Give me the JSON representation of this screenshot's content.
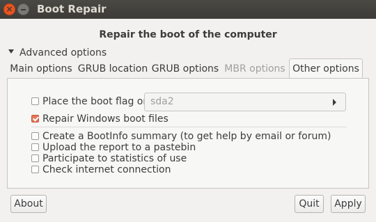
{
  "window": {
    "title": "Boot Repair",
    "close_glyph": "×"
  },
  "heading": "Repair the boot of the computer",
  "expander": {
    "label": "Advanced options",
    "expanded": true
  },
  "tabs": [
    {
      "label": "Main options",
      "state": "normal"
    },
    {
      "label": "GRUB location",
      "state": "normal"
    },
    {
      "label": "GRUB options",
      "state": "normal"
    },
    {
      "label": "MBR options",
      "state": "disabled"
    },
    {
      "label": "Other options",
      "state": "active"
    }
  ],
  "options": {
    "boot_flag": {
      "label": "Place the boot flag on:",
      "checked": false
    },
    "boot_flag_partition": {
      "value": "sda2"
    },
    "repair_windows": {
      "label": "Repair Windows boot files",
      "checked": true
    },
    "bootinfo": {
      "label": "Create a BootInfo summary (to get help by email or forum)",
      "checked": false
    },
    "pastebin": {
      "label": "Upload the report to a pastebin",
      "checked": false
    },
    "statistics": {
      "label": "Participate to statistics of use",
      "checked": false
    },
    "internet": {
      "label": "Check internet connection",
      "checked": false
    }
  },
  "buttons": {
    "about": "About",
    "quit": "Quit",
    "apply": "Apply"
  },
  "colors": {
    "titlebar": "#3c3b37",
    "close_button": "#e95420",
    "checkbox_checked": "#e2765a"
  }
}
